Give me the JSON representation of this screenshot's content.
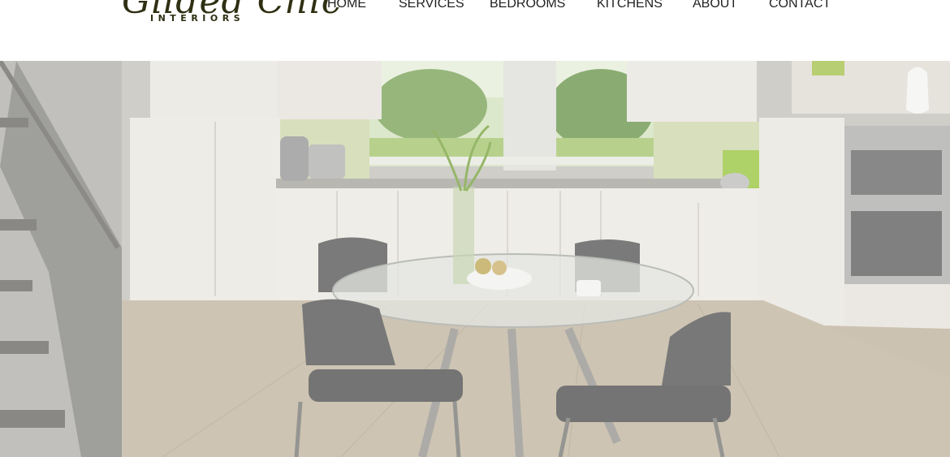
{
  "brand": {
    "script_text": "Gilded Chic",
    "sub_text": "INTERIORS"
  },
  "nav": {
    "items": [
      {
        "label": "HOME"
      },
      {
        "label": "SERVICES"
      },
      {
        "label": "BEDROOMS"
      },
      {
        "label": "KITCHENS"
      },
      {
        "label": "ABOUT"
      },
      {
        "label": "CONTACT"
      }
    ]
  },
  "hero": {
    "image_subject": "kitchen-dining-room-photo",
    "colors": {
      "floor": "#b8aa92",
      "cabinet": "#e9e6df",
      "wall": "#bfbeb7",
      "accent_green": "#8fbf2e",
      "chair": "#474747"
    }
  }
}
